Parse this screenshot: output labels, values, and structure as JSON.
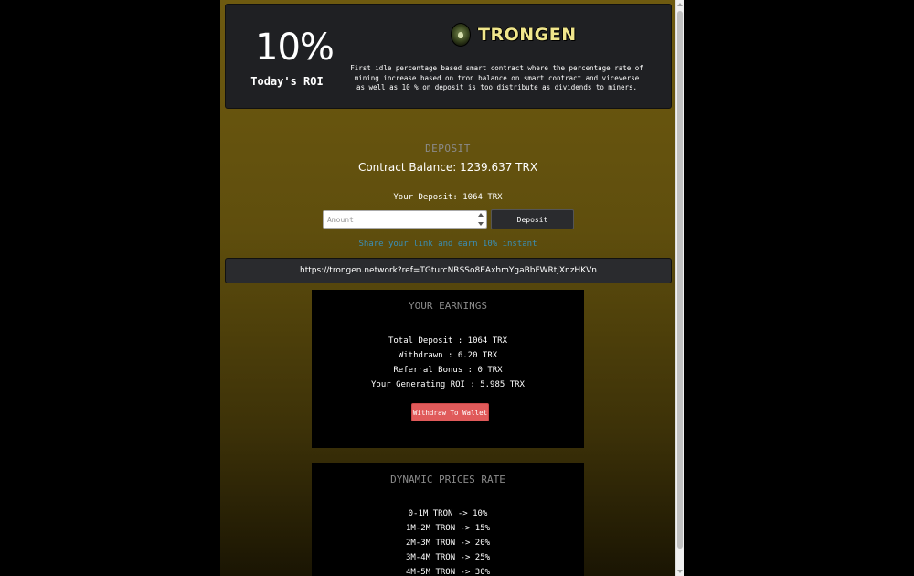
{
  "header": {
    "roi_value": "10%",
    "roi_label": "Today's ROI",
    "logo_text": "TRONGEN",
    "tagline": "First idle percentage based smart contract where the percentage rate of mining increase based on tron balance on smart contract and viceverse as well as 10 % on deposit is too distribute as dividends to miners."
  },
  "deposit": {
    "title": "DEPOSIT",
    "contract_balance": "Contract Balance: 1239.637 TRX",
    "your_deposit": "Your Deposit: 1064 TRX",
    "amount_placeholder": "Amount",
    "deposit_button": "Deposit",
    "share_text": "Share your link and earn 10% instant",
    "ref_link": "https://trongen.network?ref=TGturcNRSSo8EAxhmYgaBbFWRtjXnzHKVn"
  },
  "earnings": {
    "title": "YOUR EARNINGS",
    "lines": [
      "Total Deposit : 1064 TRX",
      "Withdrawn : 6.20 TRX",
      "Referral Bonus : 0 TRX",
      "Your Generating ROI : 5.985 TRX"
    ],
    "withdraw_button": "Withdraw To Wallet"
  },
  "prices": {
    "title": "DYNAMIC PRICES RATE",
    "lines": [
      "0-1M TRON -> 10%",
      "1M-2M TRON -> 15%",
      "2M-3M TRON -> 20%",
      "3M-4M TRON -> 25%",
      "4M-5M TRON -> 30%"
    ]
  },
  "colors": {
    "gold_background": "#6e5a10",
    "panel_dark": "#1f2023",
    "logo_text": "#f0e68c",
    "share_text": "#3a8fb7",
    "withdraw_button": "#e05a5a"
  },
  "icons": {
    "logo": "trongen-logo-icon",
    "spinner": "number-spinner-icon"
  }
}
